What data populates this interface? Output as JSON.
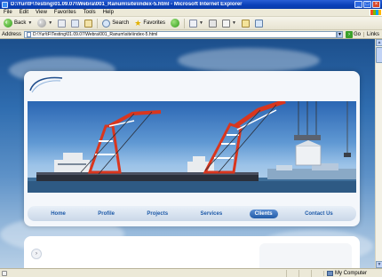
{
  "window": {
    "title": "D:\\Yur\\tF\\Testing\\01.09.07\\\\Webra\\001_Ranum\\site\\index-5.html - Microsoft Internet Explorer",
    "buttons": {
      "minimize": "_",
      "maximize": "□",
      "close": "×"
    }
  },
  "menu": [
    "File",
    "Edit",
    "View",
    "Favorites",
    "Tools",
    "Help"
  ],
  "toolbar": {
    "back_label": "Back",
    "search_label": "Search",
    "favorites_label": "Favorites"
  },
  "address": {
    "label": "Address",
    "value": "D:\\Yur\\tF\\Testing\\01.09.07\\Webra\\001_Ranum\\site\\index-5.html",
    "go_label": "Go",
    "links_label": "Links"
  },
  "site": {
    "nav": [
      {
        "label": "Home",
        "active": false
      },
      {
        "label": "Profile",
        "active": false
      },
      {
        "label": "Projects",
        "active": false
      },
      {
        "label": "Services",
        "active": false
      },
      {
        "label": "Clients",
        "active": true
      },
      {
        "label": "Contact Us",
        "active": false
      }
    ],
    "scroll_button_glyph": "›"
  },
  "status": {
    "zone_label": "My Computer"
  },
  "colors": {
    "titlebar": "#0a3fb8",
    "nav_text": "#1e5aa8",
    "nav_active": "#225ca8",
    "crane_red": "#d9361e"
  }
}
